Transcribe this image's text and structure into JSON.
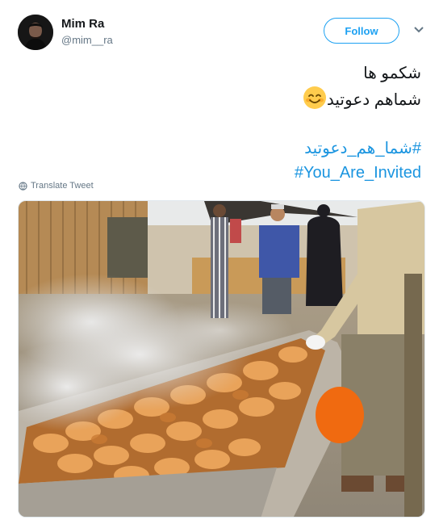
{
  "header": {
    "display_name": "Mim Ra",
    "handle": "@mim__ra",
    "follow_label": "Follow",
    "avatar_icon": "user-avatar",
    "menu_icon": "chevron-down-icon"
  },
  "tweet": {
    "line1": "شکمو ها",
    "line2": "شماهم دعوتید",
    "emoji": "smiling-face-with-heart-eyes",
    "hashtag_fa": "#شما_هم_دعوتید",
    "hashtag_en": "#You_Are_Invited"
  },
  "translate_label": "Translate Tweet",
  "translate_icon": "globe-icon",
  "media": {
    "description_icon": "photo-image"
  },
  "colors": {
    "accent": "#1da1f2",
    "link": "#1b95e0",
    "muted": "#657786"
  }
}
